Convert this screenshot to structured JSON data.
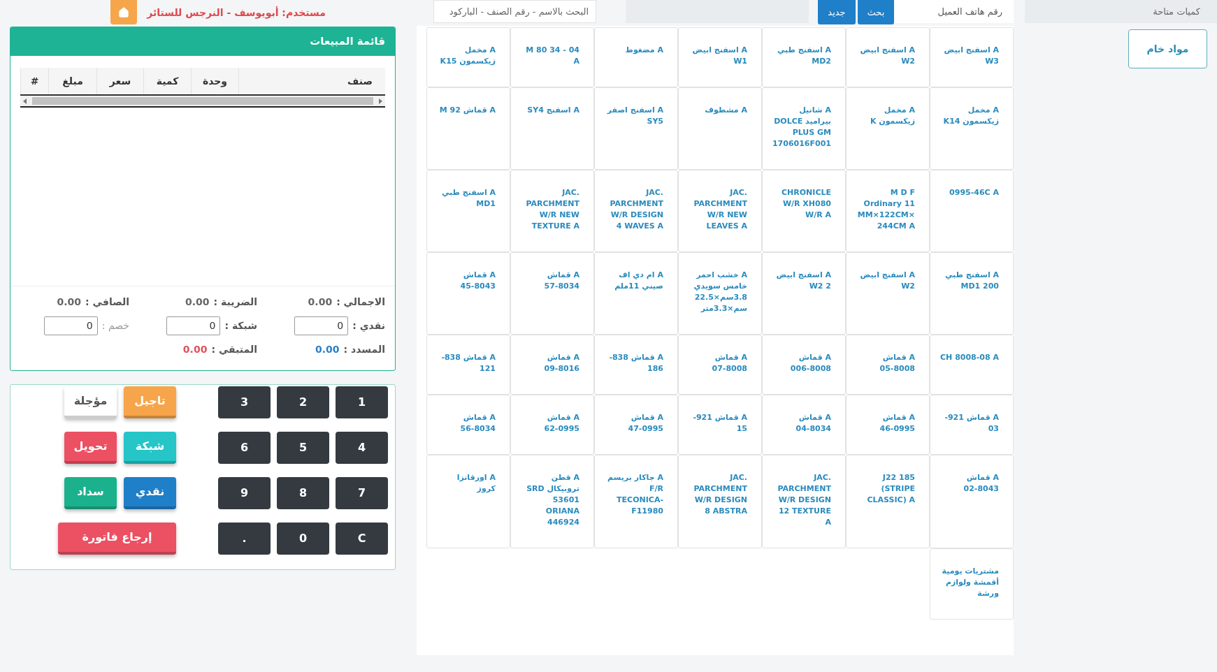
{
  "stock_panel": {
    "title": "كميات متاحة",
    "categories": [
      "مواد خام"
    ]
  },
  "customer_bar": {
    "customer_phone": {
      "placeholder": "رقم هاتف العميل"
    },
    "search_button": "بحث",
    "new_button": "جديد"
  },
  "product_search": {
    "placeholder": "البحث بالاسم - رقم الصنف - الباركود"
  },
  "products": [
    "A اسفنج ابيض W3",
    "A اسفنج ابيض W2",
    "A اسفنج طبي MD2",
    "A اسفنج ابيض W1",
    "A مضغوط",
    "M 80 34 - 04 A",
    "A مخمل زيكسمون K15",
    "A مخمل زيكسمون K14",
    "A مخمل زيكسمون K",
    "A شانيل بيراميد DOLCE PLUS GM 1706016F001",
    "A مشطوف",
    "A اسفنج اصفر SY5",
    "A اسفنج SY4",
    "A قماش M 92",
    "0995-46C A",
    "M D F Ordinary 11 MM×122CM×244CM A",
    "CHRONICLE W/R XH080 W/R A",
    "JAC. PARCHMENT W/R NEW LEAVES A",
    "JAC. PARCHMENT W/R DESIGN 4 WAVES A",
    "JAC. PARCHMENT W/R NEW TEXTURE A",
    "A اسفنج طبي MD1",
    "A اسفنج طبي MD1 200",
    "A اسفنج ابيض W2",
    "A اسفنج ابيض W2 2",
    "A خشب احمر خامس سويدي 3.8سم×22.5سم×3.3متر",
    "A ام دي اف صيني 11ملم",
    "A قماش 8034-57",
    "A قماش 8043-45",
    "CH 8008-08 A",
    "A قماش 8008-05",
    "A قماش 8008-006",
    "A قماش 8008-07",
    "A قماش 838-186",
    "A قماش 8016-09",
    "A قماش 838-121",
    "A قماش 921-03",
    "A قماش 0995-46",
    "A قماش 8034-04",
    "A قماش 921-15",
    "A قماش 0995-47",
    "A قماش 0995-62",
    "A قماش 8034-56",
    "A قماش 8043-02",
    "J22 185 (STRIPE CLASSIC) A",
    "JAC. PARCHMENT W/R DESIGN 12 TEXTURE A",
    "JAC. PARCHMENT W/R DESIGN 8 ABSTRA",
    "A جاكار بريسم F/R TECONICA-F11980",
    "A قطن تروبيكال SRD 53601 ORIANA 446924",
    "A اورقانزا كروز",
    "مشتريات يومية أقمشة ولوازم ورشة"
  ],
  "user_label": "مستخدم: أبويوسف - النرجس للستائر",
  "sales_panel": {
    "title": "قائمة المبيعات",
    "columns": [
      "صنف",
      "وحدة",
      "كمية",
      "سعر",
      "مبلغ",
      "#"
    ],
    "totals": [
      {
        "label": "الاجمالي :",
        "value": "0.00"
      },
      {
        "label": "الضريبة :",
        "value": "0.00"
      },
      {
        "label": "الصافي :",
        "value": "0.00"
      }
    ],
    "payments": [
      {
        "kind": "amount",
        "label": "نقدي :",
        "value": "0"
      },
      {
        "kind": "amount",
        "label": "شبكة :",
        "value": "0"
      },
      {
        "kind": "discount",
        "label": "خصم :",
        "value": "0"
      }
    ],
    "balance": [
      {
        "label": "المسدد :",
        "value": "0.00",
        "color": "#2a7fc9"
      },
      {
        "label": "المتبقي :",
        "value": "0.00",
        "color": "#e0525c"
      }
    ]
  },
  "keypad": {
    "keys": [
      "1",
      "2",
      "3",
      "4",
      "5",
      "6",
      "7",
      "8",
      "9",
      "C",
      "0",
      "."
    ],
    "actions": [
      {
        "kind": "single",
        "label": "تاجيل",
        "color": "#f7a54a"
      },
      {
        "kind": "single",
        "label": "مؤجلة",
        "color": "#ffffff"
      },
      {
        "kind": "single",
        "label": "شبكة",
        "color": "#25c5c8"
      },
      {
        "kind": "single",
        "label": "تحويل",
        "color": "#ec5063"
      },
      {
        "kind": "single",
        "label": "نقدي",
        "color": "#1f7fc9"
      },
      {
        "kind": "single",
        "label": "سداد",
        "color": "#1bb18d"
      },
      {
        "kind": "double",
        "label": "إرجاع فاتورة",
        "color": "#ec5063"
      }
    ]
  }
}
